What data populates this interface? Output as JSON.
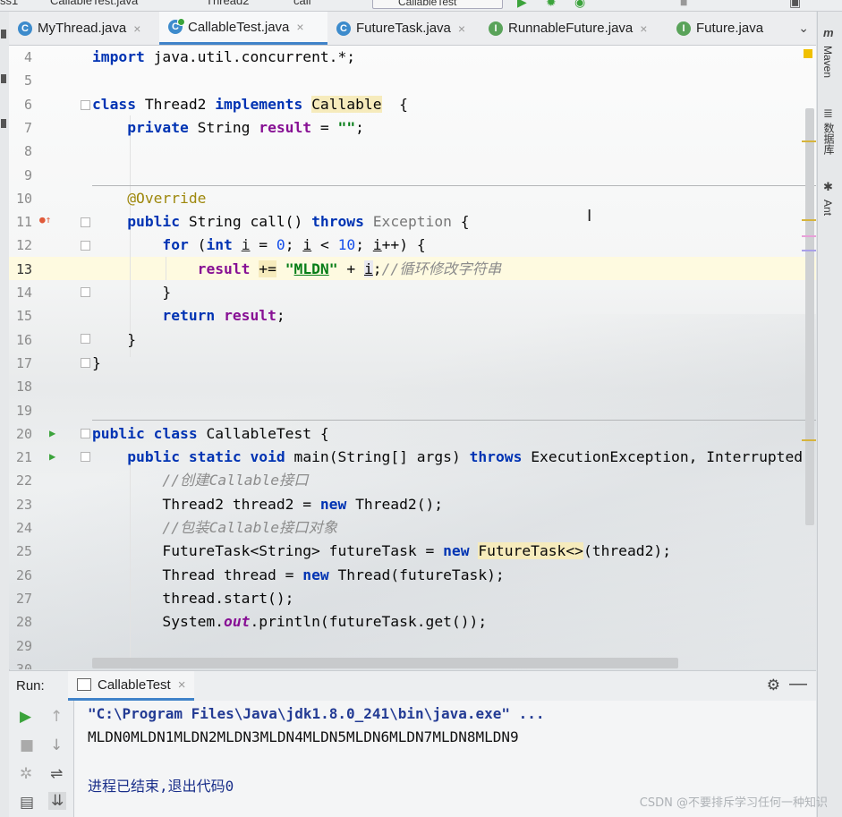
{
  "toolbar": {
    "crumbs": [
      "ss1",
      "CallableTest.java",
      "Thread2",
      "call"
    ],
    "run_config": "CallableTest"
  },
  "tabs": [
    {
      "label": "MyThread.java",
      "kind": "c",
      "active": false
    },
    {
      "label": "CallableTest.java",
      "kind": "c",
      "active": true
    },
    {
      "label": "FutureTask.java",
      "kind": "c",
      "active": false
    },
    {
      "label": "RunnableFuture.java",
      "kind": "i",
      "active": false
    },
    {
      "label": "Future.java",
      "kind": "i",
      "active": false
    }
  ],
  "right_strip": {
    "maven": "Maven",
    "database": "数据库",
    "ant": "Ant"
  },
  "editor": {
    "line_numbers": [
      "4",
      "5",
      "6",
      "7",
      "8",
      "9",
      "10",
      "11",
      "12",
      "13",
      "14",
      "15",
      "16",
      "17",
      "18",
      "19",
      "20",
      "21",
      "22",
      "23",
      "24",
      "25",
      "26",
      "27",
      "28",
      "29",
      "30"
    ],
    "current_line": "13",
    "code": {
      "l4": {
        "a": "import",
        "b": " java.util.concurrent.*;"
      },
      "l6": {
        "a": "class",
        "b": " Thread2 ",
        "c": "implements",
        "d": " ",
        "e": "Callable",
        "f": "  {"
      },
      "l7": {
        "a": "    ",
        "b": "private",
        "c": " String ",
        "d": "result",
        "e": " = ",
        "f": "\"\"",
        "g": ";"
      },
      "l10": {
        "a": "    ",
        "b": "@Override"
      },
      "l11": {
        "a": "    ",
        "b": "public",
        "c": " String call() ",
        "d": "throws",
        "e": " ",
        "f": "Exception",
        "g": " {"
      },
      "l12": {
        "a": "        ",
        "b": "for",
        "c": " (",
        "d": "int",
        "e": " ",
        "f": "i",
        "g": " = ",
        "h": "0",
        "i": "; ",
        "j": "i",
        "k": " < ",
        "l": "10",
        "m": "; ",
        "n": "i",
        "o": "++) {"
      },
      "l13": {
        "a": "            ",
        "b": "result",
        "c": " ",
        "d": "+=",
        "e": " ",
        "f": "\"",
        "g": "MLDN",
        "h": "\"",
        "i": " + ",
        "j": "i",
        "k": ";",
        "l": "//循环修改字符串"
      },
      "l14": {
        "a": "        }"
      },
      "l15": {
        "a": "        ",
        "b": "return",
        "c": " ",
        "d": "result",
        "e": ";"
      },
      "l16": {
        "a": "    }"
      },
      "l17": {
        "a": "}"
      },
      "l20": {
        "a": "public",
        "b": " ",
        "c": "class",
        "d": " CallableTest {"
      },
      "l21": {
        "a": "    ",
        "b": "public",
        "c": " ",
        "d": "static",
        "e": " ",
        "f": "void",
        "g": " main(String[] args) ",
        "h": "throws",
        "i": " ExecutionException, Interrupted"
      },
      "l22": {
        "a": "        ",
        "b": "//创建Callable接口"
      },
      "l23": {
        "a": "        Thread2 thread2 = ",
        "b": "new",
        "c": " Thread2();"
      },
      "l24": {
        "a": "        ",
        "b": "//包装Callable接口对象"
      },
      "l25": {
        "a": "        FutureTask<String> futureTask = ",
        "b": "new",
        "c": " ",
        "d": "FutureTask<>",
        "e": "(thread2);"
      },
      "l26": {
        "a": "        Thread thread = ",
        "b": "new",
        "c": " Thread(futureTask);"
      },
      "l27": {
        "a": "        thread.start();"
      },
      "l28": {
        "a": "        System.",
        "b": "out",
        "c": ".println(futureTask.get());"
      }
    }
  },
  "run_panel": {
    "label": "Run:",
    "tab": "CallableTest",
    "command": "\"C:\\Program Files\\Java\\jdk1.8.0_241\\bin\\java.exe\" ...",
    "output": "MLDN0MLDN1MLDN2MLDN3MLDN4MLDN5MLDN6MLDN7MLDN8MLDN9",
    "exit": "进程已结束,退出代码0"
  },
  "watermark": "CSDN @不要排斥学习任何一种知识",
  "colors": {
    "keyword": "#0033b3",
    "field": "#871094",
    "string": "#067d17",
    "number": "#1750eb",
    "comment": "#8c8c8c",
    "annotation": "#9e880d",
    "accent": "#4083c9"
  }
}
